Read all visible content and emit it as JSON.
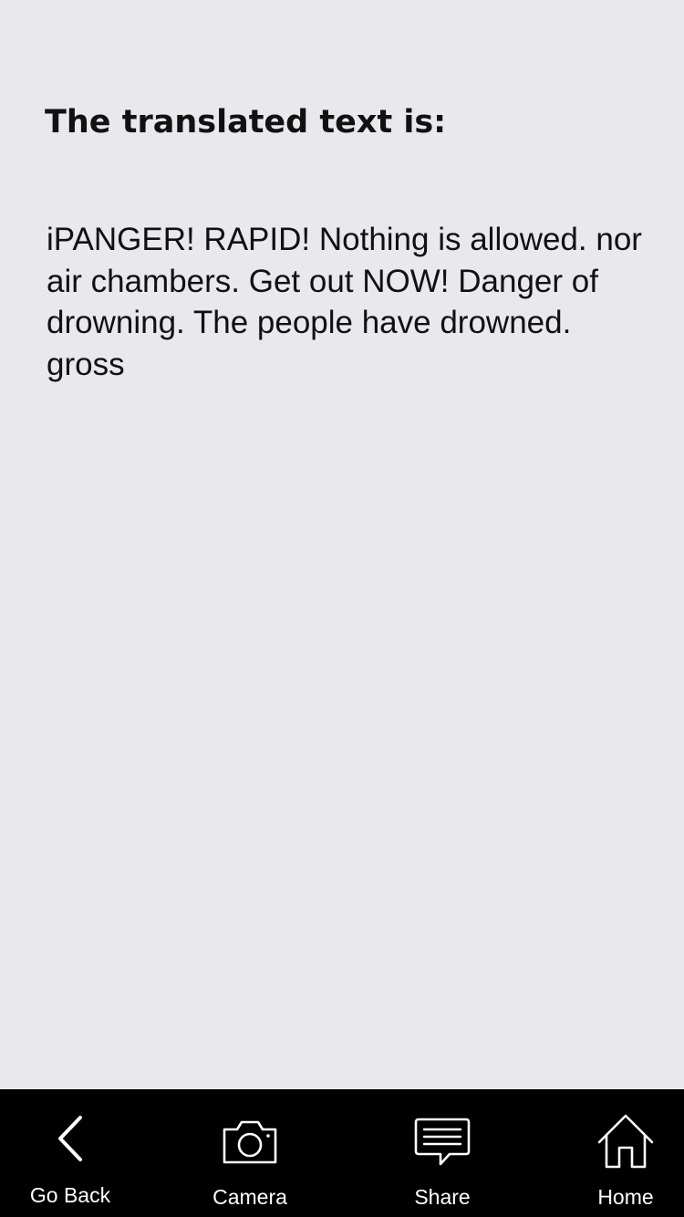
{
  "page": {
    "heading": "The translated text is:",
    "translated_text": "iPANGER! RAPID! Nothing is allowed. nor air chambers. Get out NOW! Danger of drowning. The people have drowned. gross"
  },
  "tabbar": {
    "items": [
      {
        "label": "Go Back",
        "icon": "chevron-left-icon"
      },
      {
        "label": "Camera",
        "icon": "camera-icon"
      },
      {
        "label": "Share",
        "icon": "speech-bubble-icon"
      },
      {
        "label": "Home",
        "icon": "home-icon"
      }
    ]
  },
  "colors": {
    "background": "#e9e8ed",
    "tabbar_background": "#000000",
    "tabbar_foreground": "#ffffff",
    "text": "#111111"
  }
}
